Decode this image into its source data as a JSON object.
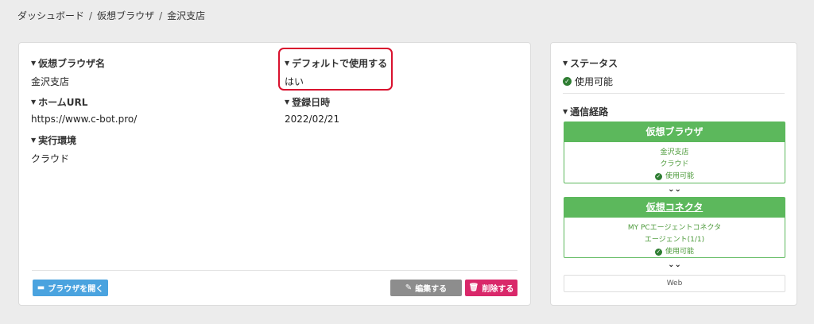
{
  "breadcrumb": [
    "ダッシュボード",
    "仮想ブラウザ",
    "金沢支店"
  ],
  "fields": {
    "name_label": "仮想ブラウザ名",
    "name_value": "金沢支店",
    "default_label": "デフォルトで使用する",
    "default_value": "はい",
    "url_label": "ホームURL",
    "url_value": "https://www.c-bot.pro/",
    "date_label": "登録日時",
    "date_value": "2022/02/21",
    "env_label": "実行環境",
    "env_value": "クラウド"
  },
  "buttons": {
    "open": "ブラウザを開く",
    "edit": "編集する",
    "delete": "削除する"
  },
  "status": {
    "label": "ステータス",
    "value": "使用可能"
  },
  "route": {
    "label": "通信経路",
    "browser": {
      "title": "仮想ブラウザ",
      "line1": "金沢支店",
      "line2": "クラウド",
      "status": "使用可能"
    },
    "connector": {
      "title": "仮想コネクタ",
      "line1": "MY PCエージェントコネクタ",
      "line2": "エージェント(1/1)",
      "status": "使用可能"
    },
    "web": "Web"
  },
  "colors": {
    "accent_green": "#5cb85c",
    "highlight_red": "#d9112e",
    "open_blue": "#4aa3df",
    "delete_pink": "#d9286a"
  }
}
